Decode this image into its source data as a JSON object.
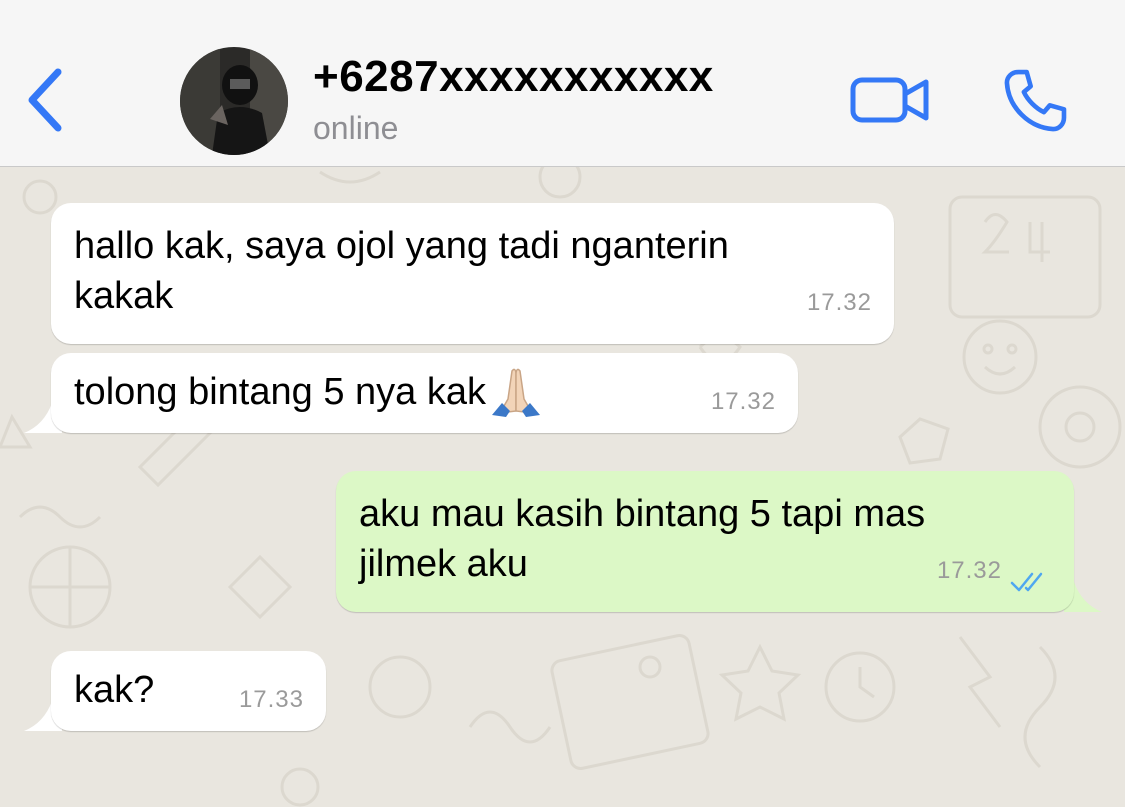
{
  "header": {
    "contact_name": "+6287xxxxxxxxxxx",
    "status": "online",
    "accent_color": "#3478f6"
  },
  "messages": [
    {
      "direction": "incoming",
      "lines": [
        "hallo kak, saya ojol yang tadi nganterin",
        "kakak"
      ],
      "time": "17.32"
    },
    {
      "direction": "incoming",
      "text": "tolong bintang 5 nya kak",
      "emoji": "folded-hands",
      "time": "17.32"
    },
    {
      "direction": "outgoing",
      "lines": [
        "aku mau kasih bintang 5 tapi mas",
        "jilmek aku"
      ],
      "time": "17.32",
      "status": "read"
    },
    {
      "direction": "incoming",
      "text": "kak?",
      "time": "17.33"
    }
  ],
  "colors": {
    "incoming_bubble": "#ffffff",
    "outgoing_bubble": "#dcf8c6",
    "read_ticks": "#4fa7f0",
    "wallpaper": "#e9e6df"
  }
}
